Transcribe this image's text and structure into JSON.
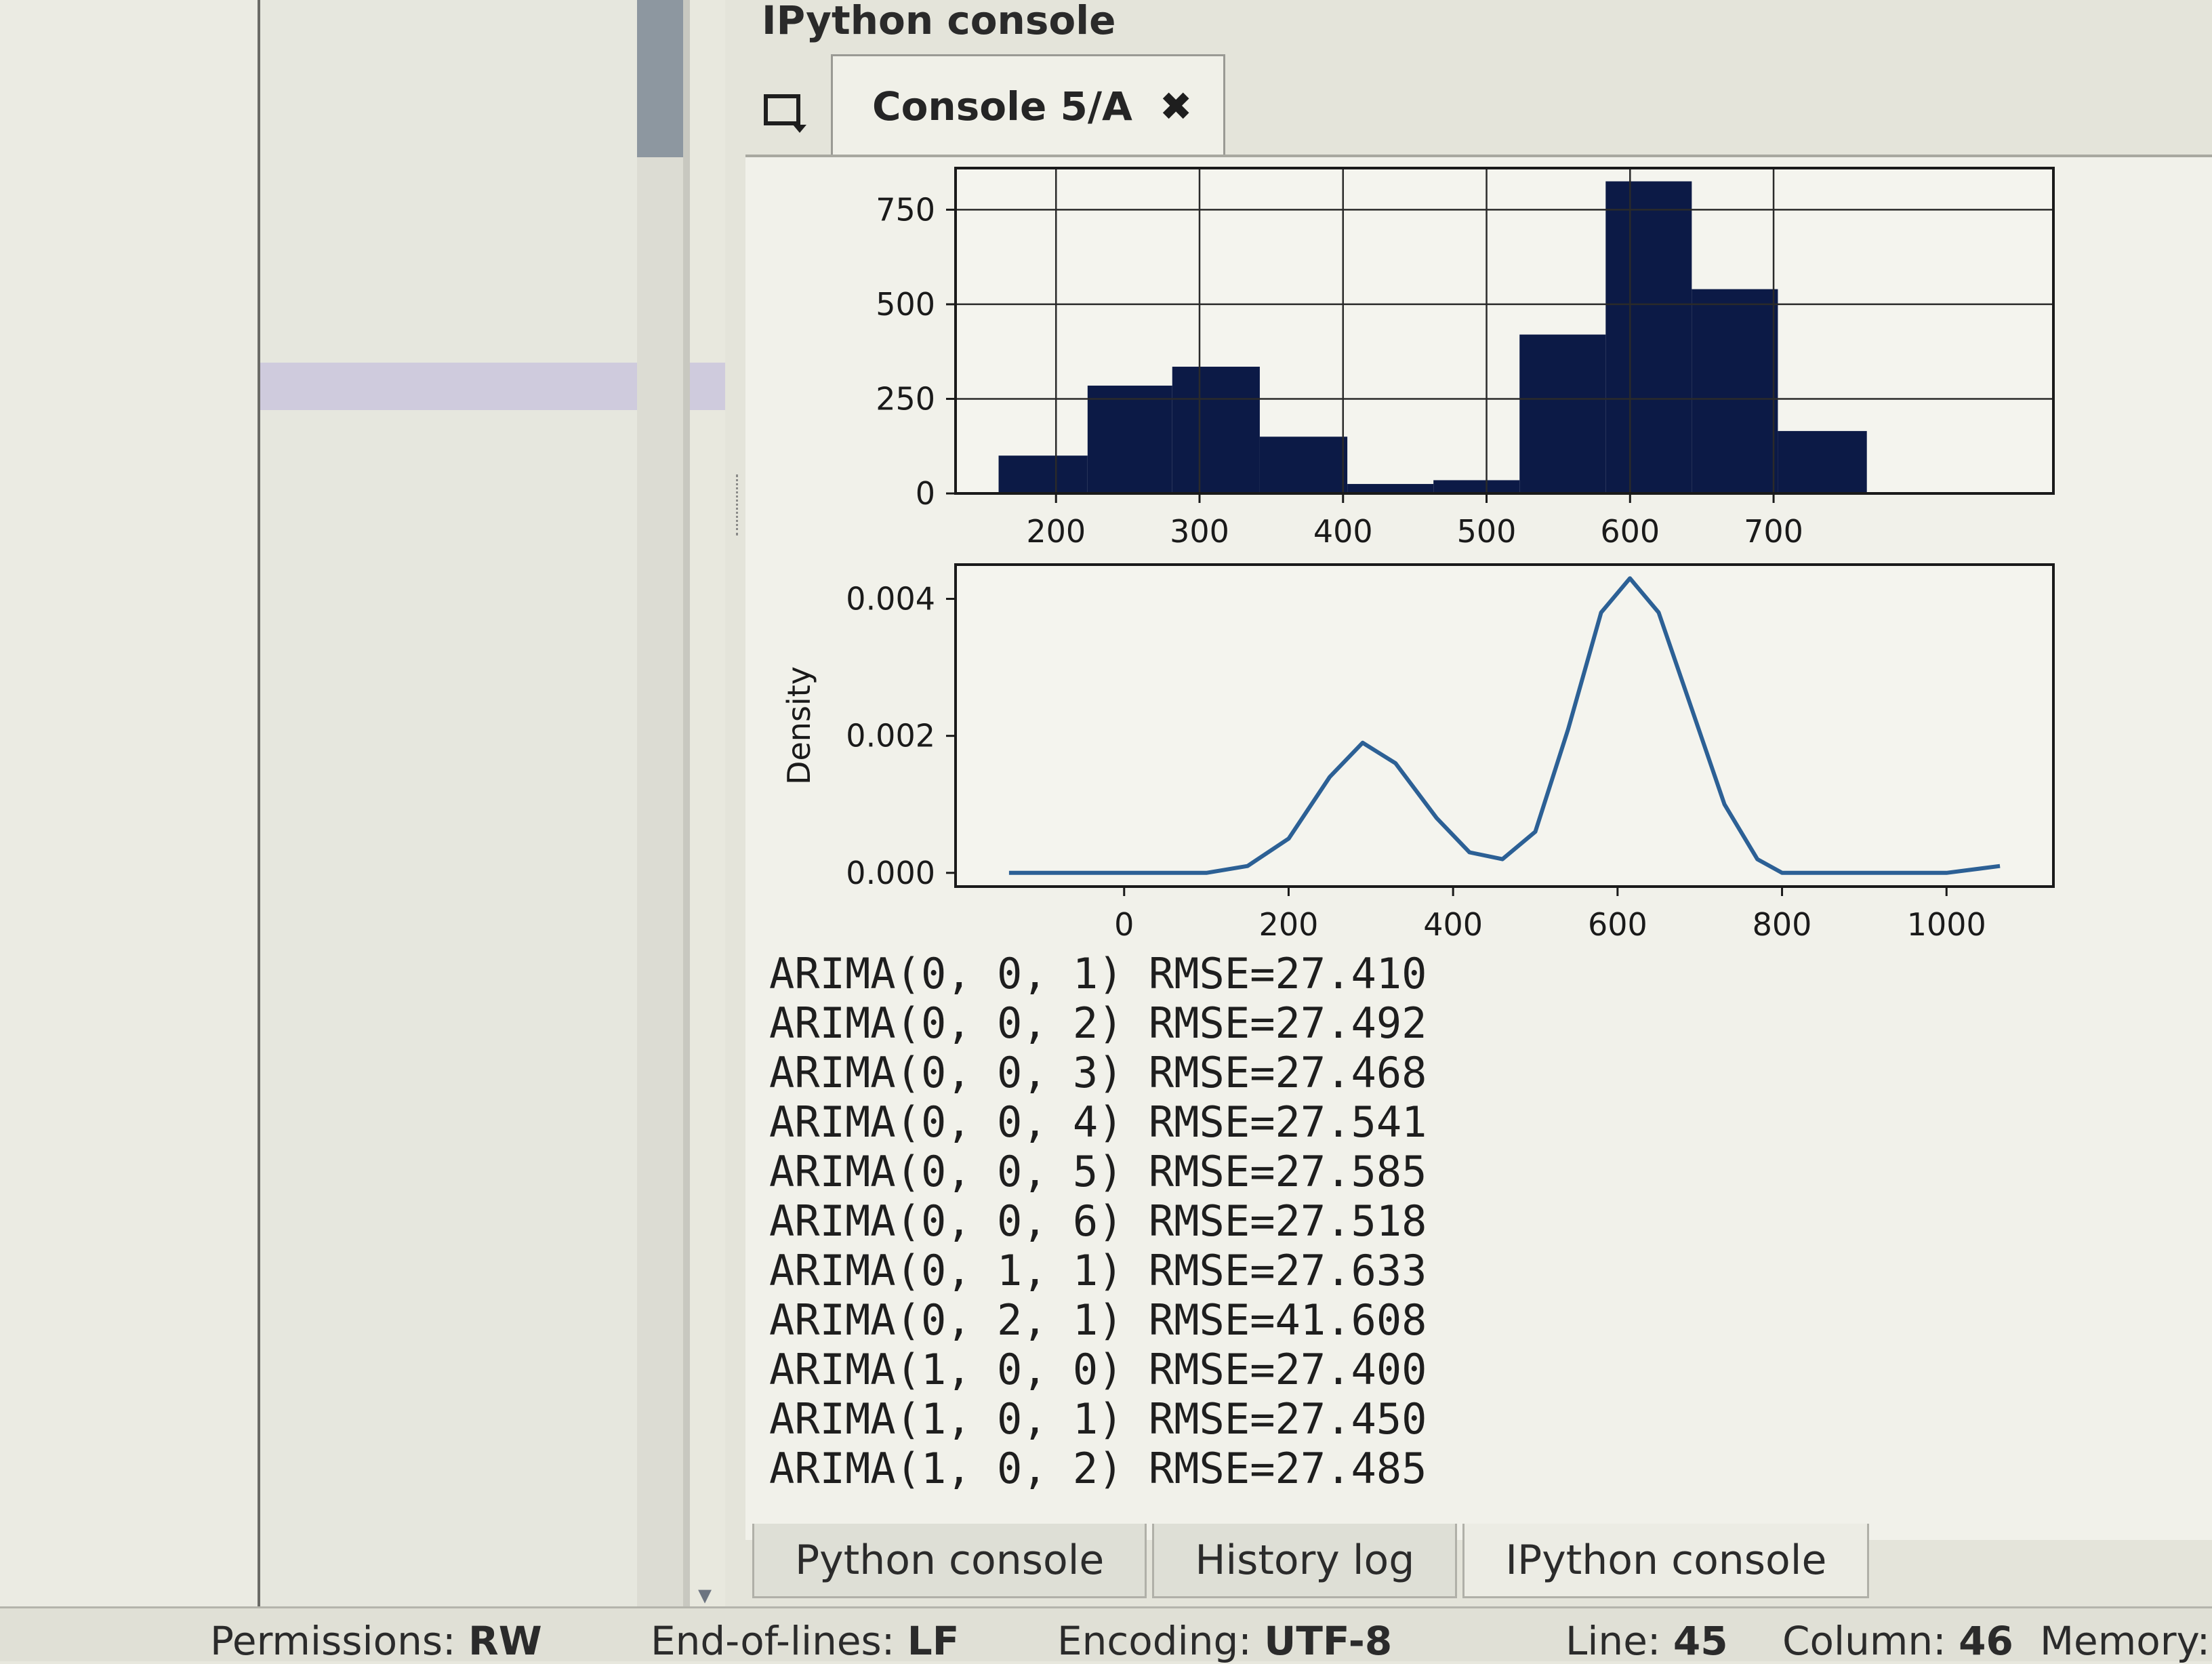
{
  "pane": {
    "title": "IPython console"
  },
  "tabs": {
    "active_label": "Console 5/A"
  },
  "histogram": {
    "type": "bar",
    "x_ticks": [
      "200",
      "300",
      "400",
      "500",
      "600",
      "700"
    ],
    "y_ticks": [
      "0",
      "250",
      "500",
      "750"
    ],
    "xlim": [
      130,
      895
    ],
    "ylim": [
      0,
      860
    ],
    "grid": true,
    "bins": [
      {
        "x0": 160,
        "x1": 222,
        "value": 100
      },
      {
        "x0": 222,
        "x1": 281,
        "value": 285
      },
      {
        "x0": 281,
        "x1": 342,
        "value": 335
      },
      {
        "x0": 342,
        "x1": 403,
        "value": 150
      },
      {
        "x0": 403,
        "x1": 463,
        "value": 25
      },
      {
        "x0": 463,
        "x1": 523,
        "value": 35
      },
      {
        "x0": 523,
        "x1": 583,
        "value": 420
      },
      {
        "x0": 583,
        "x1": 643,
        "value": 825
      },
      {
        "x0": 643,
        "x1": 703,
        "value": 540
      },
      {
        "x0": 703,
        "x1": 765,
        "value": 165
      }
    ],
    "color": "#0c1a46"
  },
  "density": {
    "type": "line",
    "ylabel": "Density",
    "x_ticks": [
      "0",
      "200",
      "400",
      "600",
      "800",
      "1000"
    ],
    "y_ticks": [
      "0.000",
      "0.002",
      "0.004"
    ],
    "xlim": [
      -205,
      1130
    ],
    "ylim": [
      -0.0002,
      0.0045
    ],
    "color": "#2c6095",
    "x": [
      -140,
      0,
      100,
      150,
      200,
      250,
      290,
      330,
      380,
      420,
      460,
      500,
      540,
      580,
      615,
      650,
      690,
      730,
      770,
      800,
      850,
      1000,
      1065
    ],
    "y": [
      0.0,
      0.0,
      0.0,
      0.0001,
      0.0005,
      0.0014,
      0.0019,
      0.0016,
      0.0008,
      0.0003,
      0.0002,
      0.0006,
      0.0021,
      0.0038,
      0.0043,
      0.0038,
      0.0024,
      0.001,
      0.0002,
      0.0,
      0.0,
      0.0,
      0.0001
    ]
  },
  "output_lines": [
    "ARIMA(0, 0, 1) RMSE=27.410",
    "ARIMA(0, 0, 2) RMSE=27.492",
    "ARIMA(0, 0, 3) RMSE=27.468",
    "ARIMA(0, 0, 4) RMSE=27.541",
    "ARIMA(0, 0, 5) RMSE=27.585",
    "ARIMA(0, 0, 6) RMSE=27.518",
    "ARIMA(0, 1, 1) RMSE=27.633",
    "ARIMA(0, 2, 1) RMSE=41.608",
    "ARIMA(1, 0, 0) RMSE=27.400",
    "ARIMA(1, 0, 1) RMSE=27.450",
    "ARIMA(1, 0, 2) RMSE=27.485"
  ],
  "bottom_tabs": [
    "Python console",
    "History log",
    "IPython console"
  ],
  "status": {
    "permissions_label": "Permissions:",
    "permissions_value": "RW",
    "eol_label": "End-of-lines:",
    "eol_value": "LF",
    "encoding_label": "Encoding:",
    "encoding_value": "UTF-8",
    "line_label": "Line:",
    "line_value": "45",
    "column_label": "Column:",
    "column_value": "46",
    "memory_label": "Memory:"
  }
}
